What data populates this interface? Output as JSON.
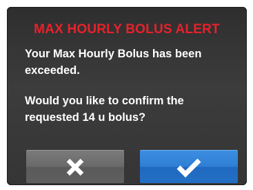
{
  "alert": {
    "title": "MAX HOURLY BOLUS ALERT",
    "title_color": "#e8212b",
    "message_line_1": "Your Max Hourly Bolus has been exceeded.",
    "message_line_2": "Would you like to confirm the requested 14 u bolus?"
  },
  "buttons": {
    "cancel_icon": "x-icon",
    "confirm_icon": "checkmark-icon",
    "cancel_color": "#6a6a6a",
    "confirm_color": "#2f7fd6"
  }
}
